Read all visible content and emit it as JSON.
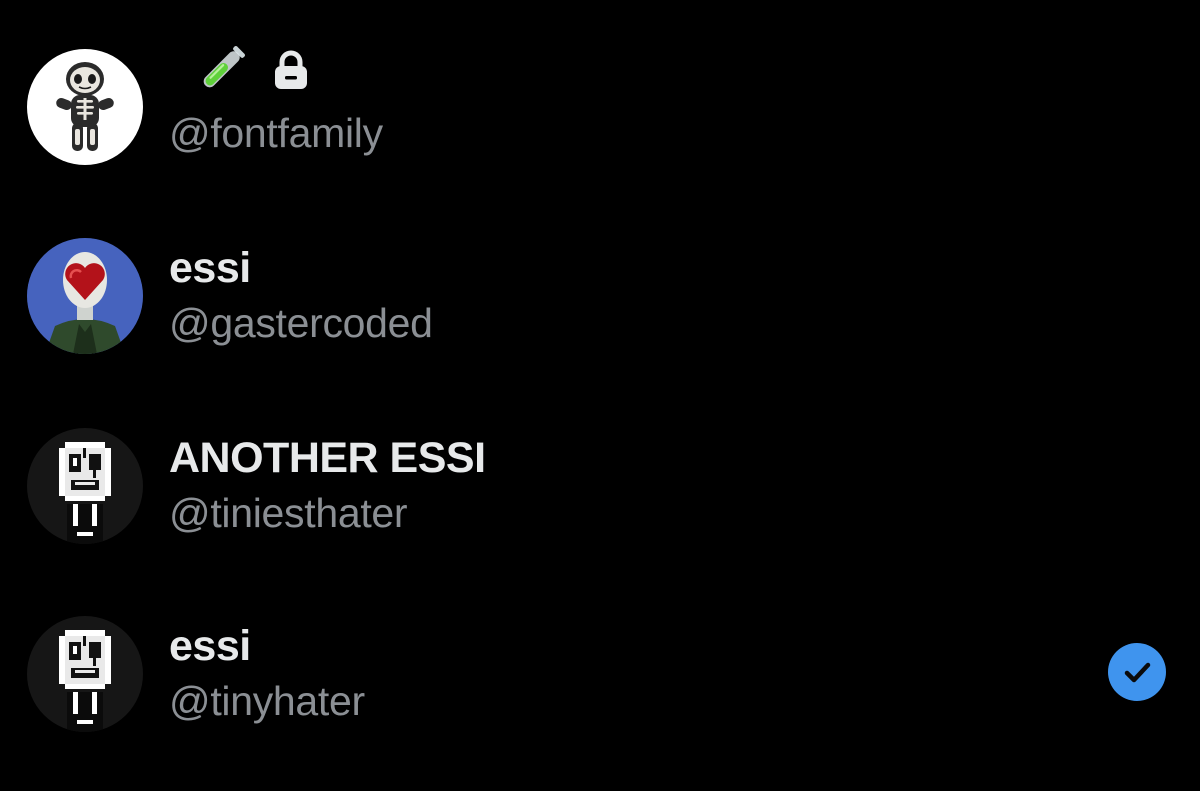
{
  "accounts": [
    {
      "display_name": "",
      "name_icons": [
        "test-tube-emoji",
        "lock-icon"
      ],
      "handle": "@fontfamily",
      "avatar": "skeleton-plush",
      "selected": false
    },
    {
      "display_name": "essi",
      "handle": "@gastercoded",
      "avatar": "heart-mask-character",
      "selected": false
    },
    {
      "display_name": "ANOTHER ESSI",
      "handle": "@tiniesthater",
      "avatar": "gaster-face",
      "selected": false
    },
    {
      "display_name": "essi",
      "handle": "@tinyhater",
      "avatar": "gaster-face",
      "selected": true,
      "status_icon": "checkmark-icon"
    }
  ],
  "colors": {
    "background": "#000000",
    "display_name": "#e7e9ea",
    "handle": "#8b8f94",
    "check_badge": "#3f94ee",
    "test_tube_liquid": "#5fd13a"
  }
}
